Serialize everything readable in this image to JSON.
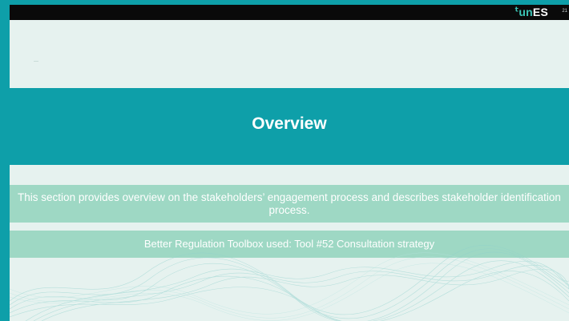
{
  "header": {
    "logo_icon": "ᵗ",
    "logo_part1": "un",
    "logo_part2": "ES",
    "page_number": "21"
  },
  "slide": {
    "title": "Overview",
    "description": "This section provides overview on the stakeholders’ engagement process and describes stakeholder identification process.",
    "toolbox_note": "Better Regulation Toolbox used: Tool #52 Consultation strategy"
  },
  "colors": {
    "frame": "#0e9fa9",
    "banner": "#0e9fa9",
    "slide_bg": "#e6f2ef",
    "box_bg": "#9ed8c4",
    "logo_accent": "#3cc6b7"
  }
}
